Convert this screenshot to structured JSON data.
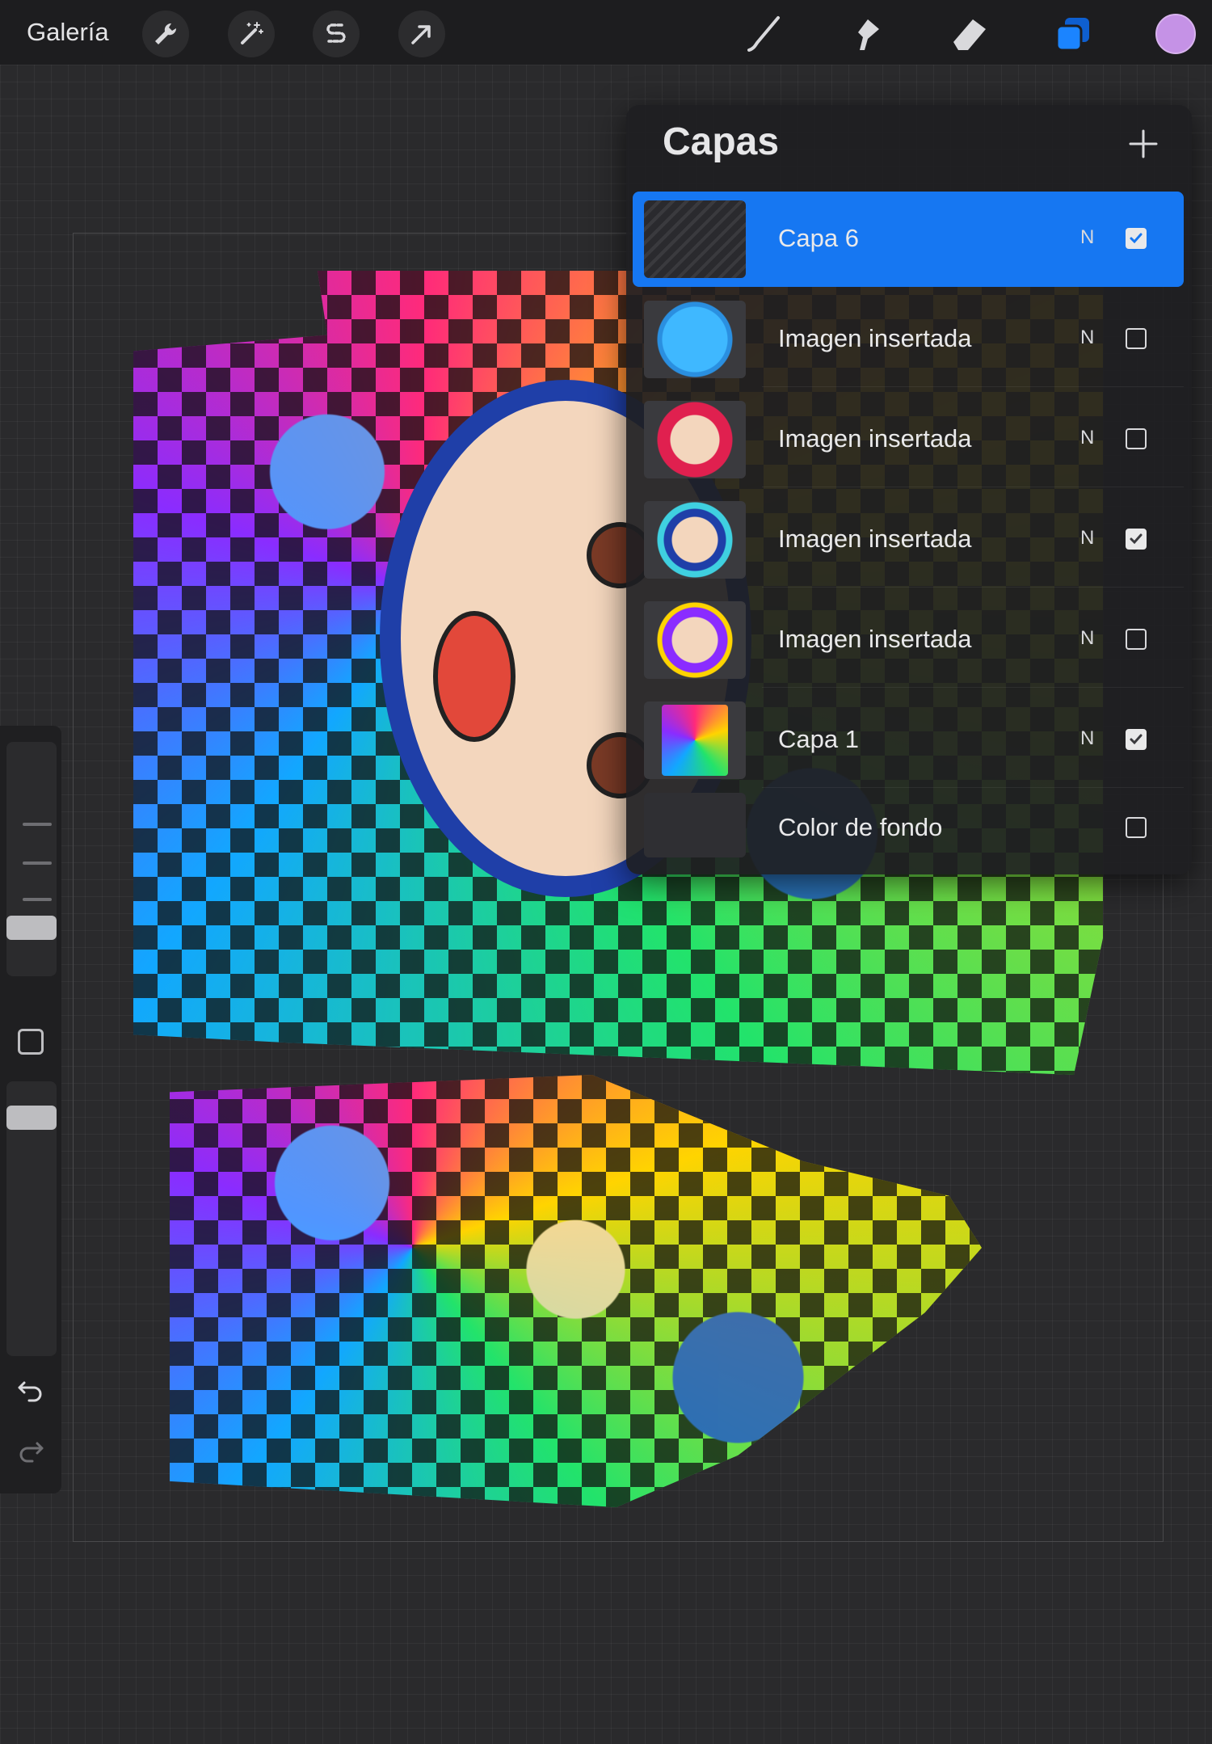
{
  "topbar": {
    "gallery_label": "Galería",
    "tools_left": [
      "wrench-icon",
      "magic-wand-icon",
      "selection-s-icon",
      "arrow-transform-icon"
    ],
    "tools_right": [
      "brush-icon",
      "smudge-icon",
      "eraser-icon",
      "layers-icon"
    ],
    "accent": "#1677f2",
    "current_color": "#c592e6"
  },
  "layers_panel": {
    "title": "Capas",
    "add_icon": "plus-icon",
    "layers": [
      {
        "name": "Capa 6",
        "mode": "N",
        "visible": true,
        "active": true
      },
      {
        "name": "Imagen insertada",
        "mode": "N",
        "visible": false,
        "active": false
      },
      {
        "name": "Imagen insertada",
        "mode": "N",
        "visible": false,
        "active": false
      },
      {
        "name": "Imagen insertada",
        "mode": "N",
        "visible": true,
        "active": false
      },
      {
        "name": "Imagen insertada",
        "mode": "N",
        "visible": false,
        "active": false
      },
      {
        "name": "Capa 1",
        "mode": "N",
        "visible": true,
        "active": false
      },
      {
        "name": "Color de fondo",
        "mode": "",
        "visible": false,
        "active": false
      }
    ]
  },
  "sidebar": {
    "controls": [
      "brush-size-slider",
      "modify-button",
      "opacity-slider",
      "undo-icon",
      "redo-icon"
    ]
  }
}
